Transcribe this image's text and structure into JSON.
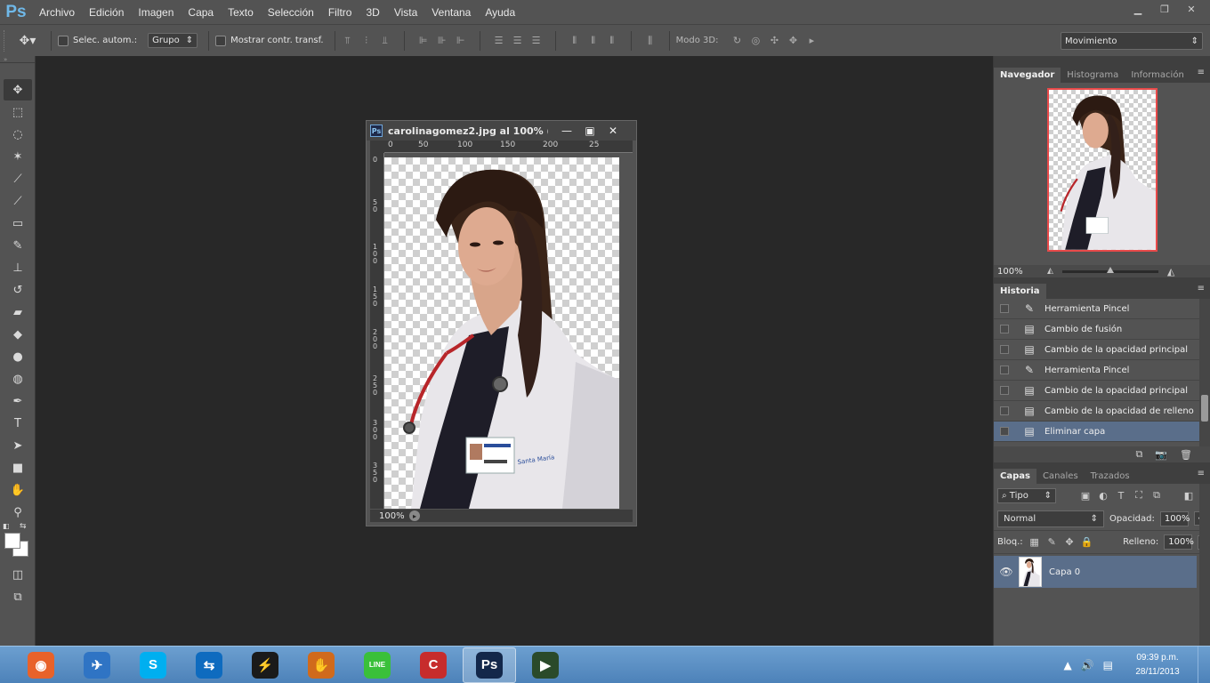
{
  "app": {
    "logo": "Ps",
    "menu": [
      "Archivo",
      "Edición",
      "Imagen",
      "Capa",
      "Texto",
      "Selección",
      "Filtro",
      "3D",
      "Vista",
      "Ventana",
      "Ayuda"
    ],
    "window_controls": [
      "minimize-icon",
      "restore-icon",
      "close-icon"
    ]
  },
  "options": {
    "tool_icon": "move-tool-icon",
    "auto_select_label": "Selec. autom.:",
    "auto_select_dropdown": "Grupo",
    "auto_select_checked": false,
    "show_transform_label": "Mostrar contr. transf.",
    "show_transform_checked": false,
    "mode3d_label": "Modo 3D:",
    "workspace_dropdown": "Movimiento"
  },
  "tools": [
    "move-tool-icon",
    "marquee-tool-icon",
    "lasso-tool-icon",
    "magic-wand-icon",
    "crop-tool-icon",
    "eyedropper-icon",
    "healing-brush-icon",
    "brush-tool-icon",
    "clone-stamp-icon",
    "history-brush-icon",
    "eraser-icon",
    "paint-bucket-icon",
    "blur-tool-icon",
    "dodge-tool-icon",
    "pen-tool-icon",
    "type-tool-icon",
    "path-selection-icon",
    "rectangle-tool-icon",
    "hand-tool-icon",
    "zoom-tool-icon"
  ],
  "colors": {
    "foreground": "#ffffff",
    "background": "#ffffff"
  },
  "document": {
    "title": "carolinagomez2.jpg al 100% (C...",
    "zoom": "100%",
    "ruler_h": [
      "0",
      "50",
      "100",
      "150",
      "200",
      "25"
    ],
    "ruler_v": [
      "0",
      "50",
      "100",
      "150",
      "200",
      "250",
      "300",
      "350"
    ]
  },
  "navigator": {
    "tabs": [
      "Navegador",
      "Histograma",
      "Información"
    ],
    "zoom": "100%"
  },
  "history": {
    "tab": "Historia",
    "items": [
      {
        "label": "Herramienta Pincel",
        "icon": "brush-icon",
        "selected": false
      },
      {
        "label": "Cambio de fusión",
        "icon": "document-icon",
        "selected": false
      },
      {
        "label": "Cambio de la opacidad principal",
        "icon": "document-icon",
        "selected": false
      },
      {
        "label": "Herramienta Pincel",
        "icon": "brush-icon",
        "selected": false
      },
      {
        "label": "Cambio de la opacidad principal",
        "icon": "document-icon",
        "selected": false
      },
      {
        "label": "Cambio de la opacidad de relleno",
        "icon": "document-icon",
        "selected": false
      },
      {
        "label": "Eliminar capa",
        "icon": "document-icon",
        "selected": true
      }
    ]
  },
  "layers": {
    "tabs": [
      "Capas",
      "Canales",
      "Trazados"
    ],
    "filter": "Tipo",
    "blend_mode": "Normal",
    "opacity_label": "Opacidad:",
    "opacity": "100%",
    "lock_label": "Bloq.:",
    "fill_label": "Relleno:",
    "fill": "100%",
    "items": [
      {
        "name": "Capa 0",
        "visible": true,
        "selected": true
      }
    ]
  },
  "taskbar": {
    "apps": [
      {
        "name": "firefox-icon",
        "color": "#e8622a",
        "glyph": "◉"
      },
      {
        "name": "messenger-icon",
        "color": "#2f74c4",
        "glyph": "✈"
      },
      {
        "name": "skype-icon",
        "color": "#00aff0",
        "glyph": "S"
      },
      {
        "name": "teamviewer-icon",
        "color": "#0e6bbf",
        "glyph": "⇆"
      },
      {
        "name": "winamp-icon",
        "color": "#1a1a1a",
        "glyph": "⚡"
      },
      {
        "name": "game-icon",
        "color": "#d06a1c",
        "glyph": "✋"
      },
      {
        "name": "line-icon",
        "color": "#3ac03a",
        "glyph": "LINE"
      },
      {
        "name": "ccleaner-icon",
        "color": "#c72c2c",
        "glyph": "C"
      },
      {
        "name": "photoshop-icon",
        "color": "#13274a",
        "glyph": "Ps"
      },
      {
        "name": "media-icon",
        "color": "#2a4a2a",
        "glyph": "▶"
      }
    ],
    "active_app": "photoshop-icon",
    "clock_time": "09:39 p.m.",
    "clock_date": "28/11/2013"
  }
}
